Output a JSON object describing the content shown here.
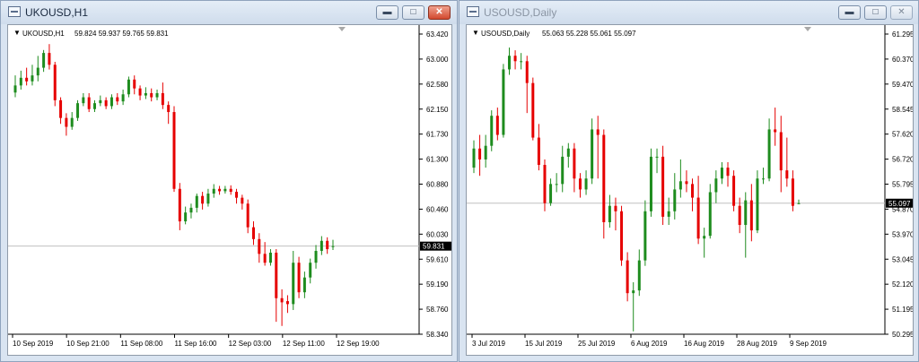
{
  "colors": {
    "bull": "#1e8c1e",
    "bear": "#e60000",
    "price_line": "#c0c0c0",
    "price_box": "#000000"
  },
  "windows": [
    {
      "title": "UKOUSD,H1",
      "active": true,
      "header": {
        "symbol": "UKOUSD,H1",
        "ohlc": "59.824 59.937 59.765 59.831"
      },
      "current_price": "59.831",
      "chart_data": {
        "type": "candlestick",
        "y_ticks": [
          "63.420",
          "63.000",
          "62.580",
          "62.150",
          "61.730",
          "61.300",
          "60.880",
          "60.460",
          "60.030",
          "59.610",
          "59.190",
          "58.760",
          "58.340"
        ],
        "x_ticks": [
          "10 Sep 2019",
          "10 Sep 21:00",
          "11 Sep 08:00",
          "11 Sep 16:00",
          "12 Sep 03:00",
          "12 Sep 11:00",
          "12 Sep 19:00"
        ],
        "ylim": [
          58.34,
          63.42
        ],
        "current": 59.831,
        "candles": [
          [
            62.43,
            62.55,
            62.35,
            62.72
          ],
          [
            62.55,
            62.68,
            62.48,
            62.8
          ],
          [
            62.68,
            62.62,
            62.55,
            62.85
          ],
          [
            62.62,
            62.72,
            62.55,
            62.9
          ],
          [
            62.72,
            62.85,
            62.62,
            63.05
          ],
          [
            62.85,
            63.1,
            62.78,
            63.15
          ],
          [
            63.1,
            62.9,
            62.82,
            63.25
          ],
          [
            62.9,
            62.3,
            62.2,
            62.95
          ],
          [
            62.3,
            62.0,
            61.9,
            62.35
          ],
          [
            62.0,
            61.85,
            61.7,
            62.08
          ],
          [
            61.85,
            62.0,
            61.8,
            62.1
          ],
          [
            62.0,
            62.25,
            61.95,
            62.3
          ],
          [
            62.25,
            62.35,
            62.2,
            62.42
          ],
          [
            62.35,
            62.15,
            62.1,
            62.42
          ],
          [
            62.15,
            62.25,
            62.1,
            62.3
          ],
          [
            62.25,
            62.3,
            62.2,
            62.38
          ],
          [
            62.3,
            62.2,
            62.15,
            62.35
          ],
          [
            62.2,
            62.35,
            62.15,
            62.4
          ],
          [
            62.35,
            62.28,
            62.22,
            62.42
          ],
          [
            62.28,
            62.4,
            62.22,
            62.48
          ],
          [
            62.4,
            62.65,
            62.35,
            62.7
          ],
          [
            62.65,
            62.5,
            62.4,
            62.72
          ],
          [
            62.5,
            62.38,
            62.3,
            62.55
          ],
          [
            62.38,
            62.42,
            62.32,
            62.52
          ],
          [
            62.42,
            62.35,
            62.28,
            62.5
          ],
          [
            62.35,
            62.42,
            62.3,
            62.48
          ],
          [
            62.42,
            62.22,
            62.15,
            62.6
          ],
          [
            62.22,
            62.1,
            61.9,
            62.28
          ],
          [
            62.1,
            60.8,
            60.75,
            62.2
          ],
          [
            60.8,
            60.25,
            60.1,
            60.9
          ],
          [
            60.25,
            60.4,
            60.2,
            60.5
          ],
          [
            60.4,
            60.48,
            60.3,
            60.55
          ],
          [
            60.48,
            60.68,
            60.4,
            60.72
          ],
          [
            60.68,
            60.55,
            60.45,
            60.75
          ],
          [
            60.55,
            60.72,
            60.5,
            60.8
          ],
          [
            60.72,
            60.8,
            60.65,
            60.88
          ],
          [
            60.8,
            60.76,
            60.7,
            60.85
          ],
          [
            60.76,
            60.8,
            60.72,
            60.85
          ],
          [
            60.8,
            60.75,
            60.7,
            60.86
          ],
          [
            60.75,
            60.65,
            60.55,
            60.8
          ],
          [
            60.65,
            60.55,
            60.45,
            60.7
          ],
          [
            60.55,
            60.15,
            60.05,
            60.62
          ],
          [
            60.15,
            59.95,
            59.85,
            60.25
          ],
          [
            59.95,
            59.7,
            59.55,
            60.05
          ],
          [
            59.7,
            59.55,
            59.5,
            59.9
          ],
          [
            59.55,
            59.72,
            59.5,
            59.78
          ],
          [
            59.72,
            58.95,
            58.55,
            59.78
          ],
          [
            58.95,
            58.88,
            58.48,
            59.1
          ],
          [
            58.9,
            58.85,
            58.7,
            59.0
          ],
          [
            58.85,
            59.55,
            58.75,
            59.75
          ],
          [
            59.55,
            59.05,
            58.95,
            59.65
          ],
          [
            59.05,
            59.3,
            58.95,
            59.4
          ],
          [
            59.3,
            59.55,
            59.2,
            59.62
          ],
          [
            59.55,
            59.75,
            59.45,
            59.85
          ],
          [
            59.75,
            59.92,
            59.68,
            60.0
          ],
          [
            59.92,
            59.78,
            59.7,
            59.98
          ],
          [
            59.824,
            59.831,
            59.765,
            59.937
          ]
        ]
      }
    },
    {
      "title": "USOUSD,Daily",
      "active": false,
      "header": {
        "symbol": "USOUSD,Daily",
        "ohlc": "55.063 55.228 55.061 55.097"
      },
      "current_price": "55.097",
      "chart_data": {
        "type": "candlestick",
        "y_ticks": [
          "61.295",
          "60.370",
          "59.470",
          "58.545",
          "57.620",
          "56.720",
          "55.795",
          "54.870",
          "53.970",
          "53.045",
          "52.120",
          "51.195",
          "50.295"
        ],
        "x_ticks": [
          "3 Jul 2019",
          "15 Jul 2019",
          "25 Jul 2019",
          "6 Aug 2019",
          "16 Aug 2019",
          "28 Aug 2019",
          "9 Sep 2019"
        ],
        "ylim": [
          50.295,
          61.295
        ],
        "current": 55.097,
        "candles": [
          [
            56.4,
            57.1,
            56.2,
            57.4
          ],
          [
            57.1,
            56.7,
            56.1,
            57.6
          ],
          [
            56.7,
            57.2,
            56.4,
            57.6
          ],
          [
            57.2,
            58.3,
            57.0,
            58.5
          ],
          [
            58.3,
            57.6,
            57.4,
            58.6
          ],
          [
            57.6,
            60.0,
            57.5,
            60.2
          ],
          [
            60.0,
            60.5,
            59.8,
            60.8
          ],
          [
            60.5,
            60.3,
            60.0,
            60.7
          ],
          [
            60.3,
            60.3,
            60.0,
            60.6
          ],
          [
            60.3,
            59.5,
            58.4,
            60.5
          ],
          [
            59.5,
            57.5,
            57.4,
            59.7
          ],
          [
            57.5,
            56.5,
            56.3,
            58.0
          ],
          [
            56.5,
            55.1,
            54.8,
            56.7
          ],
          [
            55.1,
            55.8,
            55.0,
            56.0
          ],
          [
            55.8,
            55.8,
            55.5,
            56.2
          ],
          [
            55.8,
            56.8,
            55.5,
            57.2
          ],
          [
            56.8,
            57.1,
            56.4,
            57.3
          ],
          [
            57.1,
            56.0,
            55.5,
            57.3
          ],
          [
            56.0,
            55.6,
            55.3,
            56.2
          ],
          [
            55.6,
            56.0,
            55.4,
            56.3
          ],
          [
            56.0,
            57.8,
            55.8,
            58.2
          ],
          [
            57.8,
            57.6,
            56.0,
            58.3
          ],
          [
            57.6,
            54.4,
            53.8,
            57.8
          ],
          [
            54.4,
            55.0,
            54.2,
            55.4
          ],
          [
            55.0,
            54.8,
            54.1,
            55.3
          ],
          [
            54.8,
            53.0,
            52.8,
            55.0
          ],
          [
            53.0,
            51.8,
            51.5,
            53.3
          ],
          [
            51.8,
            51.9,
            50.4,
            52.2
          ],
          [
            51.9,
            53.0,
            51.7,
            53.4
          ],
          [
            53.0,
            54.8,
            52.8,
            55.2
          ],
          [
            54.8,
            56.8,
            54.6,
            57.1
          ],
          [
            56.8,
            56.8,
            56.2,
            57.1
          ],
          [
            56.8,
            54.6,
            54.3,
            57.2
          ],
          [
            54.6,
            54.8,
            54.3,
            55.3
          ],
          [
            54.8,
            55.6,
            54.5,
            56.2
          ],
          [
            55.6,
            55.9,
            55.3,
            56.7
          ],
          [
            55.9,
            55.8,
            55.5,
            56.3
          ],
          [
            55.8,
            55.3,
            54.8,
            56.0
          ],
          [
            55.3,
            53.8,
            53.6,
            56.1
          ],
          [
            53.8,
            53.9,
            53.1,
            54.2
          ],
          [
            53.9,
            55.5,
            53.8,
            55.8
          ],
          [
            55.5,
            56.0,
            55.1,
            56.3
          ],
          [
            56.0,
            56.4,
            55.8,
            56.6
          ],
          [
            56.4,
            56.1,
            55.7,
            56.6
          ],
          [
            56.1,
            55.0,
            54.8,
            56.3
          ],
          [
            55.0,
            54.3,
            54.0,
            55.3
          ],
          [
            54.3,
            55.2,
            53.1,
            55.5
          ],
          [
            55.2,
            54.1,
            53.7,
            55.8
          ],
          [
            54.1,
            56.0,
            54.0,
            56.3
          ],
          [
            56.0,
            56.0,
            55.8,
            56.4
          ],
          [
            56.0,
            57.8,
            55.9,
            58.2
          ],
          [
            57.8,
            57.7,
            57.2,
            58.6
          ],
          [
            57.7,
            56.3,
            55.5,
            58.3
          ],
          [
            56.3,
            56.0,
            55.7,
            57.5
          ],
          [
            56.0,
            55.0,
            54.8,
            56.3
          ],
          [
            55.063,
            55.097,
            55.061,
            55.228
          ]
        ]
      }
    }
  ]
}
